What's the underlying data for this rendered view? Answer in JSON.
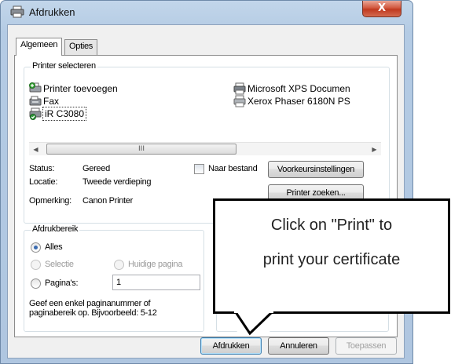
{
  "window": {
    "title": "Afdrukken",
    "close_label": "X"
  },
  "tabs": [
    {
      "label": "Algemeen",
      "active": true
    },
    {
      "label": "Opties",
      "active": false
    }
  ],
  "printer_group": {
    "title": "Printer selecteren"
  },
  "printers": [
    {
      "name": "Printer toevoegen",
      "icon": "add-printer-icon"
    },
    {
      "name": "Fax",
      "icon": "fax-icon"
    },
    {
      "name": "iR C3080",
      "icon": "default-printer-icon",
      "selected": true
    },
    {
      "name": "Microsoft XPS Documen",
      "icon": "printer-icon"
    },
    {
      "name": "Xerox Phaser 6180N PS",
      "icon": "printer-icon"
    }
  ],
  "scrollbar": {
    "thumb_grip": "III",
    "left_arrow": "◀",
    "right_arrow": "▶"
  },
  "status": {
    "status_label": "Status:",
    "status_value": "Gereed",
    "location_label": "Locatie:",
    "location_value": "Tweede verdieping",
    "comment_label": "Opmerking:",
    "comment_value": "Canon Printer"
  },
  "print_to_file": {
    "label": "Naar bestand",
    "checked": false
  },
  "buttons": {
    "preferences": "Voorkeursinstellingen",
    "find_printer": "Printer zoeken...",
    "print": "Afdrukken",
    "cancel": "Annuleren",
    "apply": "Toepassen"
  },
  "range_group": {
    "title": "Afdrukbereik",
    "all": "Alles",
    "selection": "Selectie",
    "current_page": "Huidige pagina",
    "pages": "Pagina's:",
    "pages_value": "1",
    "hint_line1": "Geef een enkel paginanummer of",
    "hint_line2": "paginabereik op. Bijvoorbeeld: 5-12"
  },
  "callout": {
    "line1": "Click on \"Print\" to",
    "line2": "print your certificate"
  },
  "colors": {
    "selected_radio": "#3a6bb0",
    "default_button_border": "#3c7fb1",
    "close_button": "#c7412a"
  }
}
